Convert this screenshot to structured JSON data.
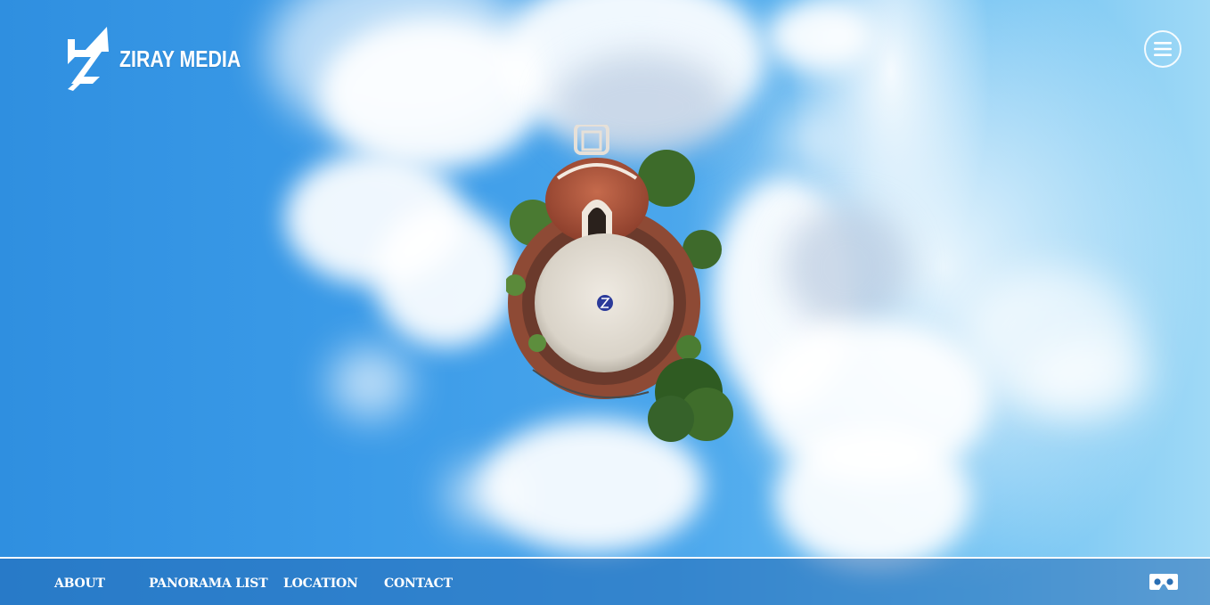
{
  "brand": {
    "name": "ZIRAY MEDIA",
    "logo_icon": "ziray-z-logo-icon"
  },
  "header": {
    "menu_icon": "hamburger-menu-icon"
  },
  "nav": {
    "items": [
      {
        "label": "ABOUT"
      },
      {
        "label": "PANORAMA LIST"
      },
      {
        "label": "LOCATION"
      },
      {
        "label": "CONTACT"
      }
    ],
    "vr_icon": "vr-headset-icon"
  },
  "colors": {
    "sky": "#3b9be8",
    "nav_bg": "#2369b4",
    "text": "#ffffff",
    "brick": "#b5543a"
  }
}
